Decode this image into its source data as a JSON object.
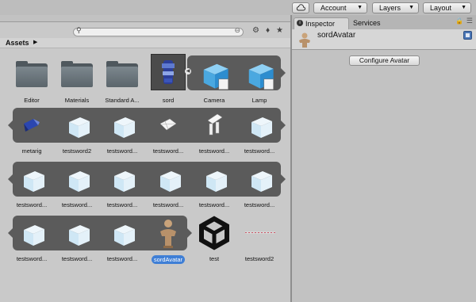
{
  "toolbar": {
    "account_label": "Account",
    "layers_label": "Layers",
    "layout_label": "Layout"
  },
  "project": {
    "breadcrumb": "Assets",
    "search_placeholder": "",
    "rows": [
      [
        "Editor",
        "Materials",
        "Standard A...",
        "sord",
        "Camera",
        "Lamp"
      ],
      [
        "metarig",
        "testsword2",
        "testsword...",
        "testsword...",
        "testsword...",
        "testsword..."
      ],
      [
        "testsword...",
        "testsword...",
        "testsword...",
        "testsword...",
        "testsword...",
        "testsword..."
      ],
      [
        "testsword...",
        "testsword...",
        "testsword...",
        "sordAvatar",
        "test",
        "testsword2"
      ]
    ],
    "selected_label": "sordAvatar"
  },
  "inspector": {
    "tab_inspector": "Inspector",
    "tab_services": "Services",
    "object_name": "sordAvatar",
    "configure_button": "Configure Avatar"
  },
  "colors": {
    "selection_blue": "#3f7fd6",
    "strip_dark": "#5b5b5b",
    "cube_light": "#cfe7f5"
  }
}
